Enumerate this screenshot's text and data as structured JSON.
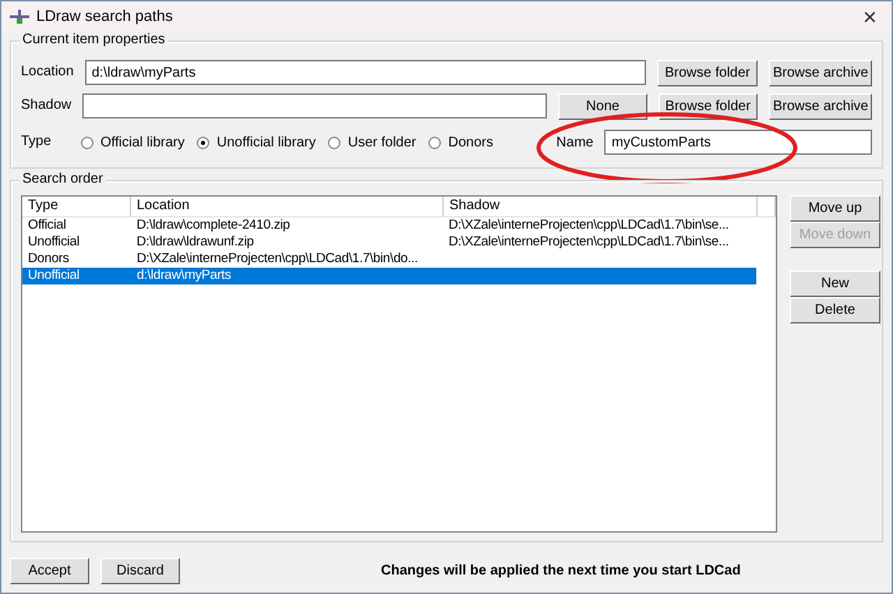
{
  "window": {
    "title": "LDraw search paths",
    "close": "✕"
  },
  "properties": {
    "title": "Current item properties",
    "location": {
      "label": "Location",
      "value": "d:\\ldraw\\myParts",
      "buttons": [
        "Browse folder",
        "Browse archive"
      ]
    },
    "shadow": {
      "label": "Shadow",
      "buttons": [
        "None",
        "Browse folder",
        "Browse archive"
      ]
    },
    "type": {
      "label": "Type",
      "options": [
        {
          "label": "Official library",
          "selected": false
        },
        {
          "label": "Unofficial library",
          "selected": true
        },
        {
          "label": "User folder",
          "selected": false
        },
        {
          "label": "Donors",
          "selected": false
        }
      ]
    },
    "name": {
      "label": "Name",
      "value": "myCustomParts"
    }
  },
  "search_order": {
    "title": "Search order",
    "columns": [
      "Type",
      "Location",
      "Shadow"
    ],
    "rows": [
      {
        "cells": [
          "Official",
          "D:\\ldraw\\complete-2410.zip",
          "D:\\XZale\\interneProjecten\\cpp\\LDCad\\1.7\\bin\\se..."
        ],
        "selected": false
      },
      {
        "cells": [
          "Unofficial",
          "D:\\ldraw\\ldrawunf.zip",
          "D:\\XZale\\interneProjecten\\cpp\\LDCad\\1.7\\bin\\se..."
        ],
        "selected": false
      },
      {
        "cells": [
          "Donors",
          "D:\\XZale\\interneProjecten\\cpp\\LDCad\\1.7\\bin\\do..."
        ],
        "selected": false
      },
      {
        "cells": [
          "Unofficial",
          "d:\\ldraw\\myParts"
        ],
        "selected": true
      }
    ],
    "buttons": [
      {
        "label": "Move up",
        "disabled": false
      },
      {
        "label": "Move down",
        "disabled": true
      },
      {
        "label": "New",
        "disabled": false
      },
      {
        "label": "Delete",
        "disabled": false
      }
    ]
  },
  "footer": {
    "buttons": [
      "Accept",
      "Discard"
    ],
    "message": "Changes will be applied the next time you start LDCad"
  }
}
